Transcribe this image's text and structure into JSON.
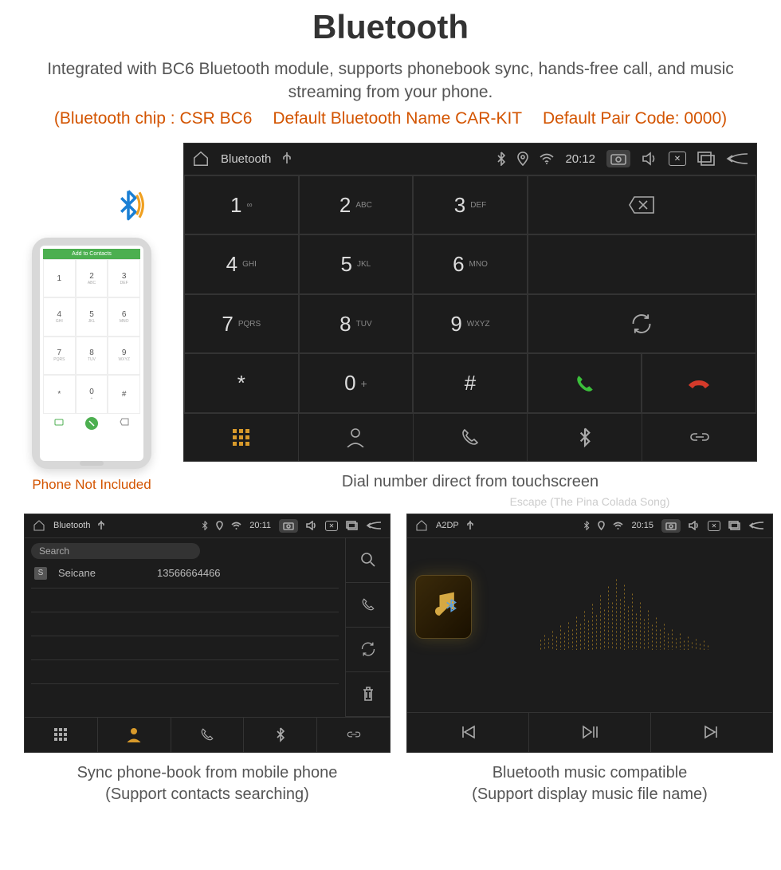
{
  "header": {
    "title": "Bluetooth",
    "subtitle": "Integrated with BC6 Bluetooth module, supports phonebook sync, hands-free call, and music streaming from your phone.",
    "spec_chip": "(Bluetooth chip : CSR BC6",
    "spec_name": "Default Bluetooth Name CAR-KIT",
    "spec_code": "Default Pair Code: 0000)"
  },
  "phone": {
    "caption": "Phone Not Included",
    "header": "Add to Contacts",
    "keys": [
      {
        "d": "1",
        "s": ""
      },
      {
        "d": "2",
        "s": "ABC"
      },
      {
        "d": "3",
        "s": "DEF"
      },
      {
        "d": "4",
        "s": "GHI"
      },
      {
        "d": "5",
        "s": "JKL"
      },
      {
        "d": "6",
        "s": "MNO"
      },
      {
        "d": "7",
        "s": "PQRS"
      },
      {
        "d": "8",
        "s": "TUV"
      },
      {
        "d": "9",
        "s": "WXYZ"
      },
      {
        "d": "*",
        "s": ""
      },
      {
        "d": "0",
        "s": "+"
      },
      {
        "d": "#",
        "s": ""
      }
    ]
  },
  "dialer": {
    "status": {
      "title": "Bluetooth",
      "time": "20:12"
    },
    "keys": [
      {
        "d": "1",
        "s": "∞"
      },
      {
        "d": "2",
        "s": "ABC"
      },
      {
        "d": "3",
        "s": "DEF"
      },
      {
        "d": "4",
        "s": "GHI"
      },
      {
        "d": "5",
        "s": "JKL"
      },
      {
        "d": "6",
        "s": "MNO"
      },
      {
        "d": "7",
        "s": "PQRS"
      },
      {
        "d": "8",
        "s": "TUV"
      },
      {
        "d": "9",
        "s": "WXYZ"
      },
      {
        "d": "*",
        "s": ""
      },
      {
        "d": "0",
        "s": "+"
      },
      {
        "d": "#",
        "s": ""
      }
    ],
    "caption": "Dial number direct from touchscreen"
  },
  "contacts": {
    "status": {
      "title": "Bluetooth",
      "time": "20:11"
    },
    "search_placeholder": "Search",
    "rows": [
      {
        "badge": "S",
        "name": "Seicane",
        "number": "13566664466"
      }
    ],
    "caption_l1": "Sync phone-book from mobile phone",
    "caption_l2": "(Support contacts searching)"
  },
  "music": {
    "status": {
      "title": "A2DP",
      "time": "20:15"
    },
    "song": "Escape (The Pina Colada Song)",
    "caption_l1": "Bluetooth music compatible",
    "caption_l2": "(Support display music file name)"
  }
}
